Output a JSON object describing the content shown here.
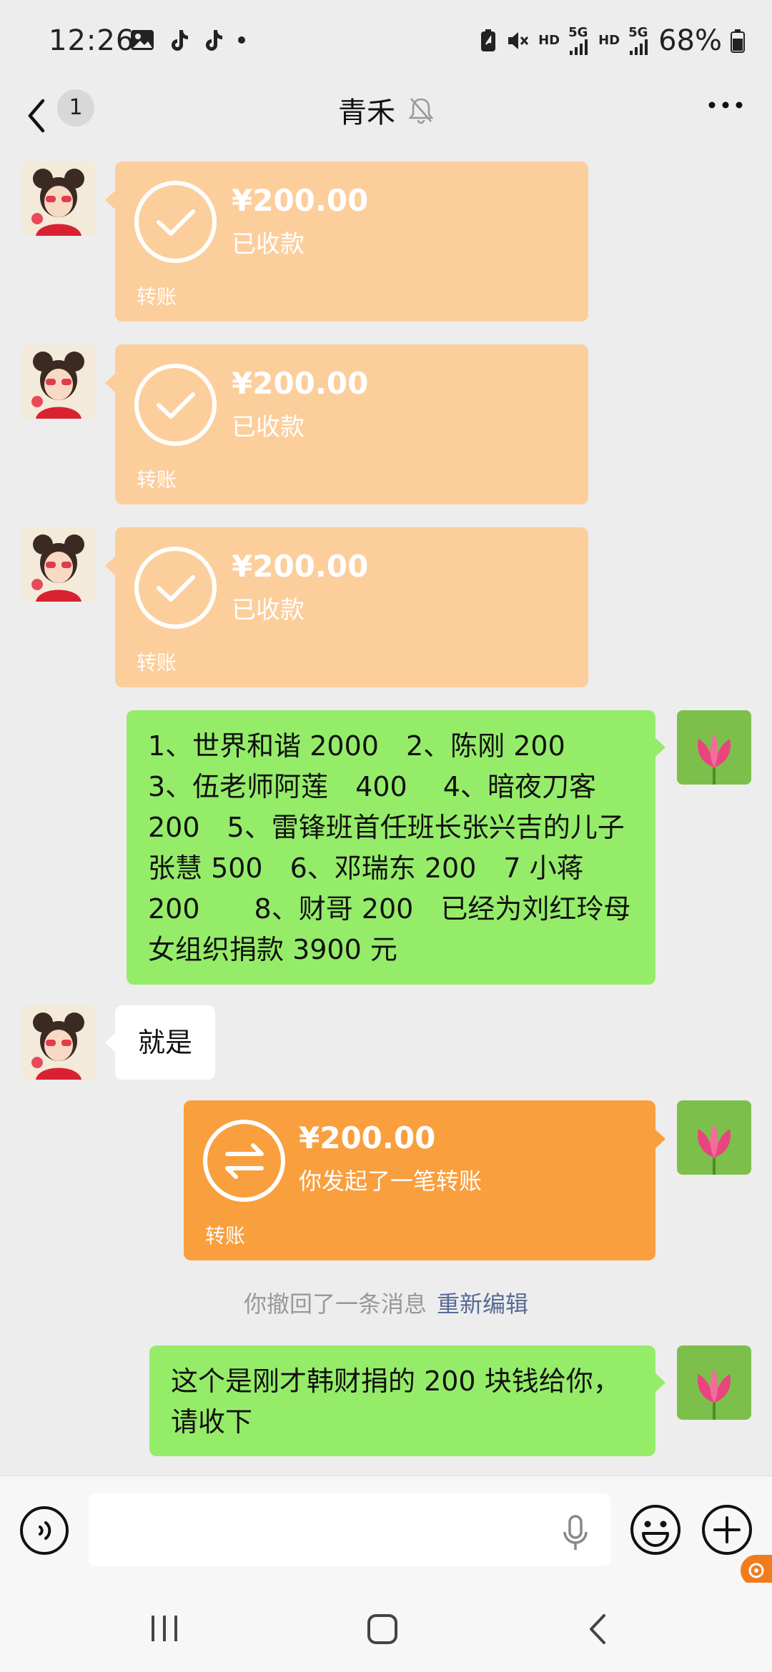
{
  "status_bar": {
    "time": "12:26",
    "battery": "68%",
    "net_hd_1": "HD",
    "net_5g_1": "5G",
    "net_hd_2": "HD",
    "net_5g_2": "5G"
  },
  "header": {
    "unread_count": "1",
    "title": "青禾"
  },
  "messages": {
    "transfer_received": {
      "amount": "¥200.00",
      "status": "已收款",
      "label": "转账"
    },
    "donation_text": "1、世界和谐 2000　2、陈刚 200　3、伍老师阿莲　400　 4、暗夜刀客 200　5、雷锋班首任班长张兴吉的儿子张慧 500　6、邓瑞东 200　7 小蒋 200　　8、财哥 200　已经为刘红玲母女组织捐款 3900 元",
    "reply_text": "就是",
    "transfer_sent": {
      "amount": "¥200.00",
      "status": "你发起了一笔转账",
      "label": "转账"
    },
    "recall_notice": "你撤回了一条消息",
    "recall_action": "重新编辑",
    "last_text": "这个是刚才韩财捐的 200 块钱给你，请收下"
  },
  "input": {
    "placeholder": ""
  },
  "colors": {
    "received_transfer": "#fcce9c",
    "sent_transfer": "#f99f3e",
    "my_bubble": "#95ec69",
    "link": "#576b95"
  },
  "icons": {
    "voice": "voice-toggle-icon",
    "mic": "mic-icon",
    "emoji": "emoji-icon",
    "plus": "plus-icon"
  }
}
